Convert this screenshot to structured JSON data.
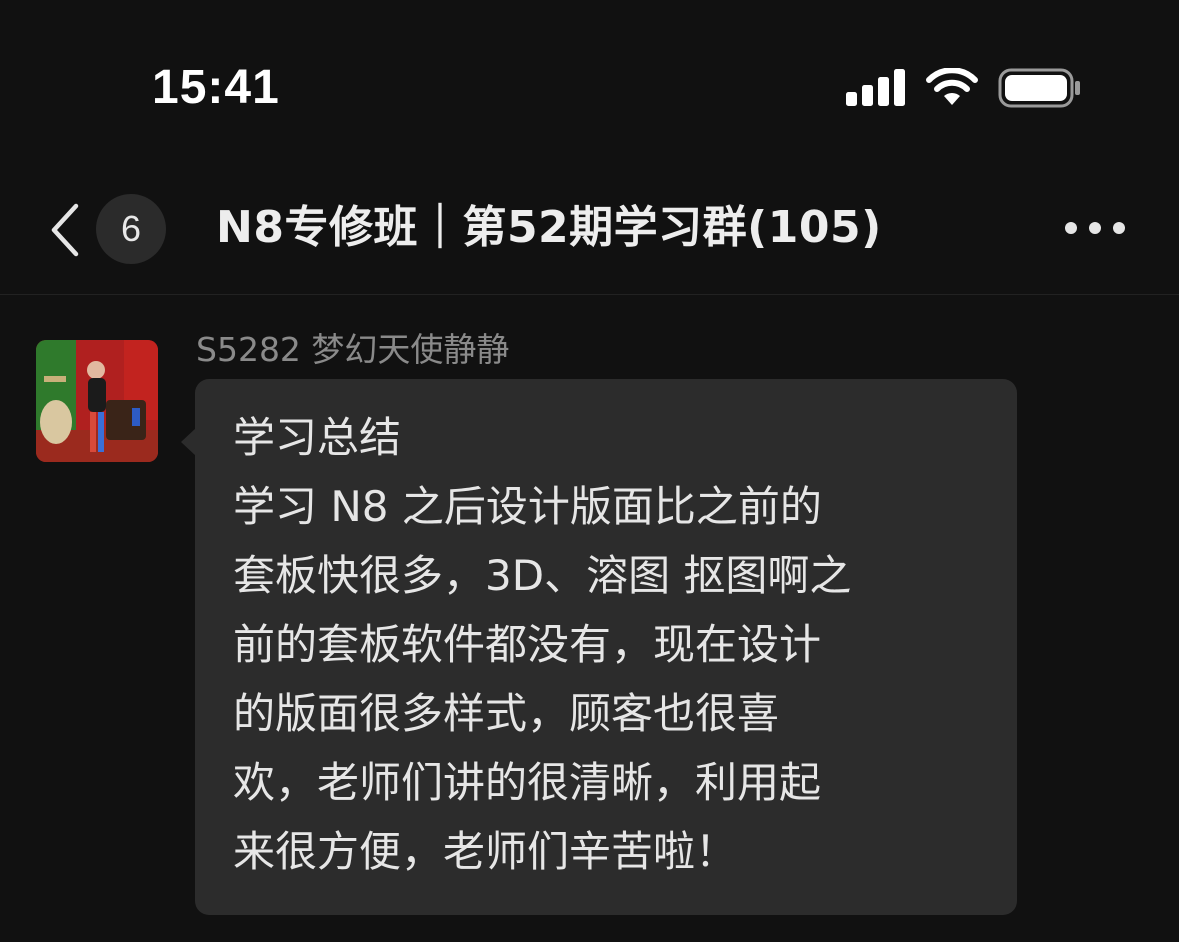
{
  "status_bar": {
    "time": "15:41"
  },
  "nav": {
    "unread_count": "6",
    "title": "N8专修班｜第52期学习群(105)"
  },
  "message": {
    "sender": "S5282 梦幻天使静静",
    "lines": [
      "学习总结",
      "学习 N8 之后设计版面比之前的",
      "套板快很多，3D、溶图 抠图啊之",
      "前的套板软件都没有，现在设计",
      "的版面很多样式，顾客也很喜",
      "欢，老师们讲的很清晰，利用起",
      "来很方便，老师们辛苦啦！"
    ]
  },
  "icons": {
    "signal": "cellular-signal-icon",
    "wifi": "wifi-icon",
    "battery": "battery-icon",
    "back": "chevron-left-icon",
    "more": "more-horizontal-icon"
  },
  "colors": {
    "background": "#111111",
    "bubble": "#2c2c2c",
    "sender_name": "#8a8a8a"
  }
}
